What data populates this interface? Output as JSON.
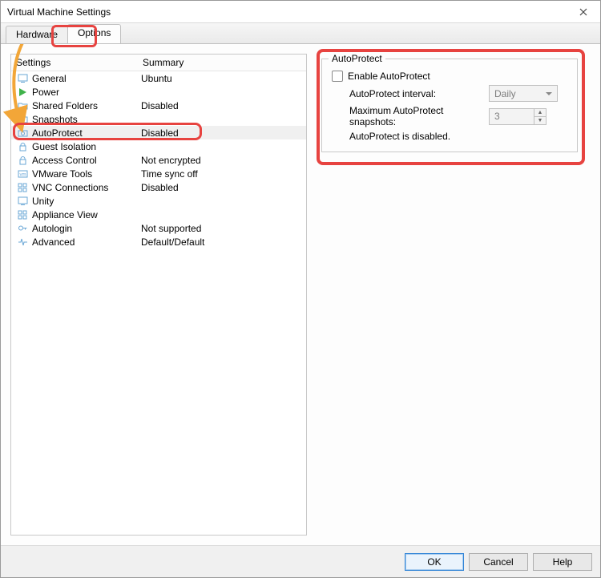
{
  "window": {
    "title": "Virtual Machine Settings"
  },
  "tabs": {
    "hardware": "Hardware",
    "options": "Options"
  },
  "list": {
    "header_name": "Settings",
    "header_summary": "Summary",
    "items": [
      {
        "icon": "monitor-icon",
        "name": "General",
        "summary": "Ubuntu"
      },
      {
        "icon": "play-icon",
        "name": "Power",
        "summary": ""
      },
      {
        "icon": "folder-icon",
        "name": "Shared Folders",
        "summary": "Disabled"
      },
      {
        "icon": "camera-icon",
        "name": "Snapshots",
        "summary": ""
      },
      {
        "icon": "camera-icon",
        "name": "AutoProtect",
        "summary": "Disabled"
      },
      {
        "icon": "lock-icon",
        "name": "Guest Isolation",
        "summary": ""
      },
      {
        "icon": "lock-icon",
        "name": "Access Control",
        "summary": "Not encrypted"
      },
      {
        "icon": "vm-icon",
        "name": "VMware Tools",
        "summary": "Time sync off"
      },
      {
        "icon": "grid-icon",
        "name": "VNC Connections",
        "summary": "Disabled"
      },
      {
        "icon": "monitor-icon",
        "name": "Unity",
        "summary": ""
      },
      {
        "icon": "grid-icon",
        "name": "Appliance View",
        "summary": ""
      },
      {
        "icon": "key-icon",
        "name": "Autologin",
        "summary": "Not supported"
      },
      {
        "icon": "pulse-icon",
        "name": "Advanced",
        "summary": "Default/Default"
      }
    ]
  },
  "right": {
    "group_title": "AutoProtect",
    "enable_label": "Enable AutoProtect",
    "interval_label": "AutoProtect interval:",
    "interval_value": "Daily",
    "max_label": "Maximum AutoProtect snapshots:",
    "max_value": "3",
    "status": "AutoProtect is disabled."
  },
  "footer": {
    "ok": "OK",
    "cancel": "Cancel",
    "help": "Help"
  }
}
